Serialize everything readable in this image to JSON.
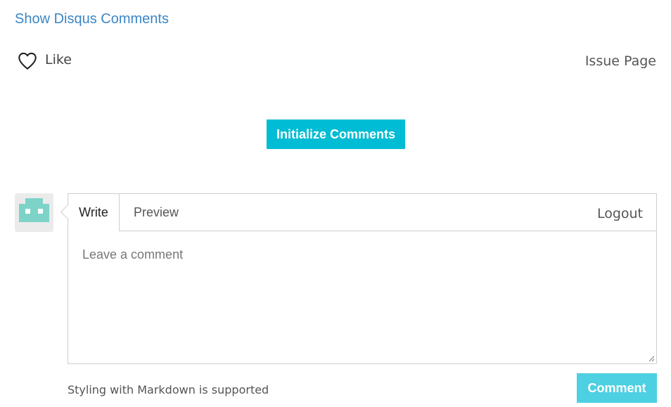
{
  "disqus": {
    "label": "Show Disqus Comments"
  },
  "like": {
    "label": "Like",
    "icon": "heart-outline-icon"
  },
  "issue_page": {
    "label": "Issue Page"
  },
  "init_button": {
    "label": "Initialize Comments",
    "color": "#00bcd4"
  },
  "editor": {
    "avatar_icon": "robot-avatar-icon",
    "avatar_color": "#7dd3c8",
    "tabs": [
      {
        "label": "Write",
        "active": true
      },
      {
        "label": "Preview",
        "active": false
      }
    ],
    "logout_label": "Logout",
    "placeholder": "Leave a comment",
    "value": ""
  },
  "footer": {
    "markdown_note": "Styling with Markdown is supported",
    "comment_button": "Comment",
    "comment_button_color": "#4dd0e1"
  }
}
